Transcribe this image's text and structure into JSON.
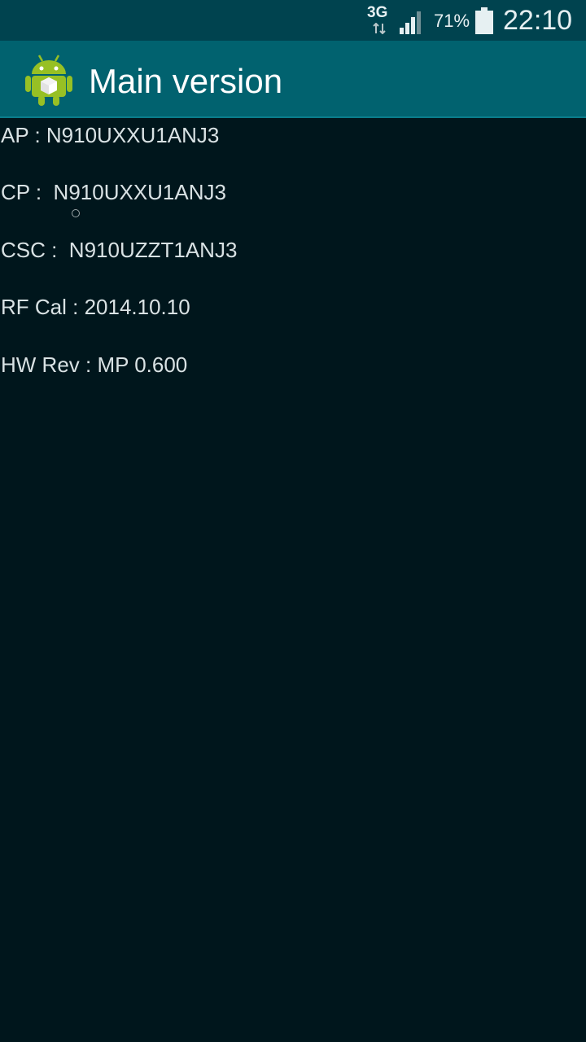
{
  "status_bar": {
    "network_label": "3G",
    "battery_percent": "71%",
    "time": "22:10",
    "icons": [
      "data-transfer-icon",
      "signal-strength-icon",
      "battery-icon"
    ]
  },
  "action_bar": {
    "title": "Main version",
    "icon": "android-robot-icon"
  },
  "info": {
    "ap": "AP : N910UXXU1ANJ3",
    "cp": "CP :  N910UXXU1ANJ3",
    "csc": "CSC :  N910UZZT1ANJ3",
    "rf_cal": "RF Cal : 2014.10.10",
    "hw_rev": "HW Rev : MP 0.600"
  },
  "colors": {
    "status_bar_bg": "#00434f",
    "action_bar_bg": "#01626f",
    "background": "#00161c",
    "text": "#d9e2e4"
  }
}
